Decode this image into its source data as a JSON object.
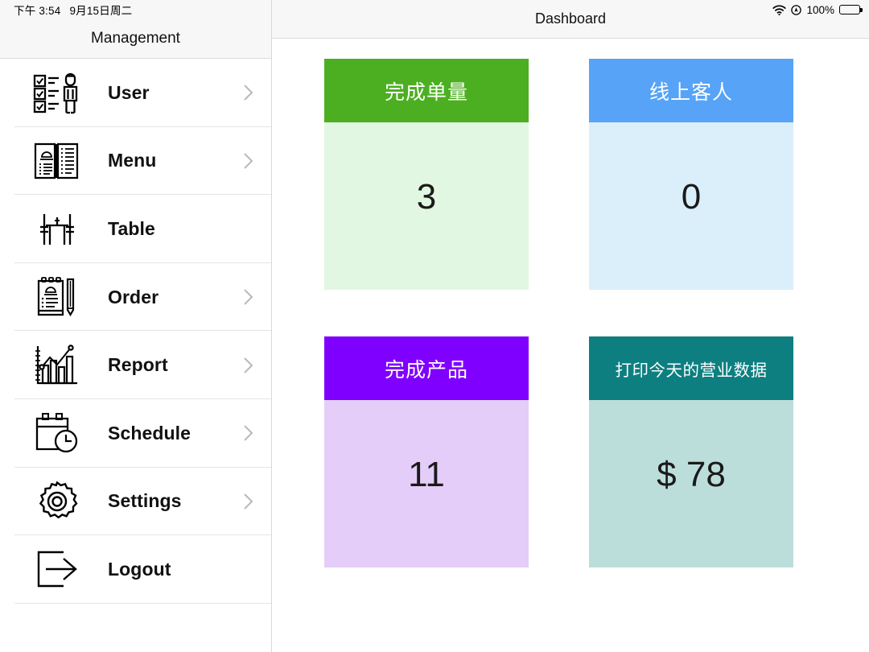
{
  "status_bar": {
    "time": "下午 3:54",
    "date": "9月15日周二",
    "wifi_icon": "wifi-icon",
    "location_icon": "location-services-icon",
    "battery_percent": "100%",
    "battery_icon": "battery-full-icon"
  },
  "sidebar": {
    "title": "Management",
    "items": [
      {
        "label": "User",
        "icon": "user-checklist-icon",
        "chevron": true
      },
      {
        "label": "Menu",
        "icon": "open-book-menu-icon",
        "chevron": true
      },
      {
        "label": "Table",
        "icon": "dining-table-icon",
        "chevron": false
      },
      {
        "label": "Order",
        "icon": "clipboard-pen-icon",
        "chevron": true
      },
      {
        "label": "Report",
        "icon": "bar-chart-icon",
        "chevron": true
      },
      {
        "label": "Schedule",
        "icon": "calendar-clock-icon",
        "chevron": true
      },
      {
        "label": "Settings",
        "icon": "gear-icon",
        "chevron": true
      },
      {
        "label": "Logout",
        "icon": "exit-arrow-icon",
        "chevron": false
      }
    ],
    "chevron_icon": "chevron-right-icon"
  },
  "navbar": {
    "title": "Dashboard"
  },
  "dashboard": {
    "cards": [
      {
        "title": "完成单量",
        "value": "3",
        "header_color": "#4CAF21",
        "body_color": "#E2F7E1",
        "name": "completed-orders-card"
      },
      {
        "title": "线上客人",
        "value": "0",
        "header_color": "#56A3F7",
        "body_color": "#DBEFFA",
        "name": "online-guests-card"
      },
      {
        "title": "完成产品",
        "value": "11",
        "header_color": "#8000FF",
        "body_color": "#E4CDF8",
        "name": "completed-products-card"
      },
      {
        "title": "打印今天的营业数据",
        "value": "$ 78",
        "header_color": "#0D7F80",
        "body_color": "#BCDEDB",
        "name": "print-today-sales-card"
      }
    ]
  }
}
